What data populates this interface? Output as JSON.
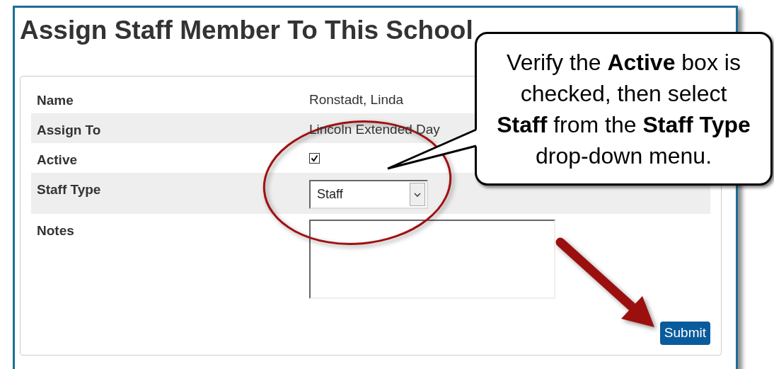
{
  "page": {
    "title": "Assign Staff Member To This School"
  },
  "form": {
    "rows": [
      {
        "kind": "text",
        "label": "Name",
        "value": "Ronstadt, Linda"
      },
      {
        "kind": "text",
        "label": "Assign To",
        "value": "Lincoln Extended Day"
      },
      {
        "kind": "checkbox",
        "label": "Active",
        "checked": true
      },
      {
        "kind": "select",
        "label": "Staff Type",
        "value": "Staff"
      },
      {
        "kind": "textarea",
        "label": "Notes"
      }
    ],
    "submit": "Submit"
  },
  "callout": {
    "text": "Verify the **Active** box is checked, then select **Staff** from the **Staff Type** drop-down menu."
  }
}
